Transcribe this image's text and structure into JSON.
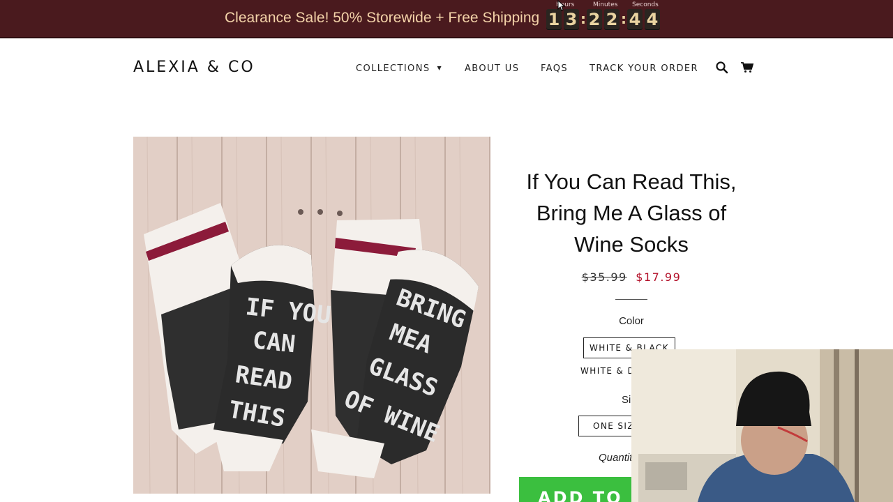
{
  "announcement": {
    "text": "Clearance Sale! 50% Storewide + Free Shipping",
    "timer": {
      "hours_label": "Hours",
      "minutes_label": "Minutes",
      "seconds_label": "Seconds",
      "digits": [
        "1",
        "3",
        "2",
        "2",
        "4",
        "4"
      ],
      "separator": ":"
    }
  },
  "header": {
    "logo": "ALEXIA & CO",
    "nav": {
      "collections": "COLLECTIONS",
      "about": "ABOUT US",
      "faqs": "FAQS",
      "track": "TRACK YOUR ORDER"
    },
    "icons": [
      "search-icon",
      "cart-icon"
    ]
  },
  "product": {
    "title": "If You Can Read This, Bring Me A Glass of Wine Socks",
    "compare_price": "$35.99",
    "sale_price": "$17.99",
    "color_label": "Color",
    "color_options": [
      "WHITE & BLACK",
      "WHITE & D"
    ],
    "selected_color": "WHITE & BLACK",
    "size_label": "Si",
    "size_options": [
      "ONE SIZE"
    ],
    "quantity_label": "Quantit",
    "add_to_cart": "ADD TO C",
    "image_text": [
      "IF YOU",
      "CAN",
      "READ",
      "THIS",
      "BRING",
      "MEA",
      "GLASS",
      "OF WINE"
    ]
  },
  "colors": {
    "announcement_bg": "#4a1a1e",
    "announcement_text": "#f3d2a8",
    "sale_price": "#b3112a",
    "add_to_cart_bg": "#3bbf3f"
  }
}
